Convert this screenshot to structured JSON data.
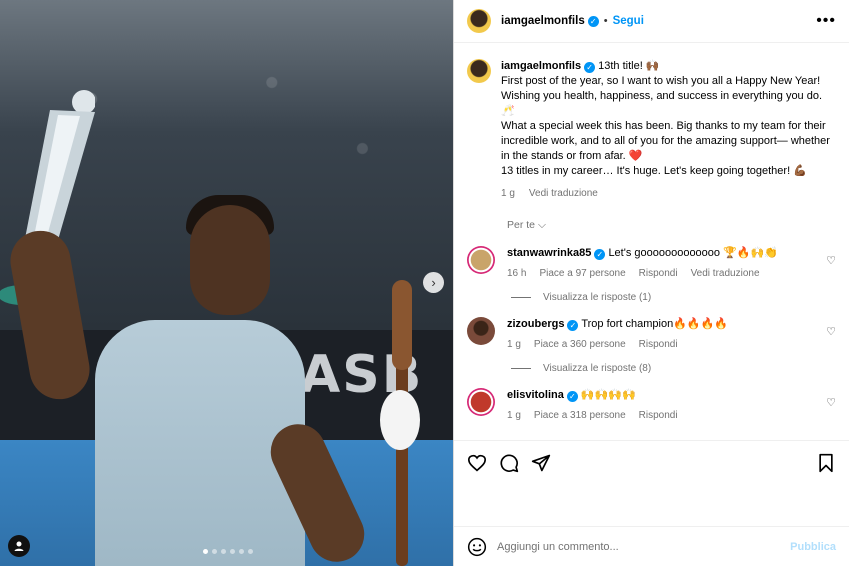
{
  "post": {
    "username": "iamgaelmonfils",
    "follow_label": "Segui",
    "separator": "•",
    "more": "•••",
    "caption_lines": [
      "13th title! 🙌🏾",
      "First post of the year, so I want to wish you all a Happy New Year! Wishing you health, happiness, and success in everything you do. 🥂",
      "What a special week this has been. Big thanks to my team for their incredible work, and to all of you for the amazing support— whether in the stands or from afar. ❤️",
      "13 titles in my career… It's huge. Let's keep going together! 💪🏾"
    ],
    "caption_time": "1 g",
    "caption_translate": "Vedi traduzione",
    "photo": {
      "banner_text": "ASB",
      "carousel_total": 6,
      "carousel_index": 1
    }
  },
  "sort": {
    "label": "Per te",
    "chevron": "chevron-down-icon"
  },
  "comments": [
    {
      "username": "stanwawrinka85",
      "text": "Let's gooooooooooooo 🏆🔥🙌👏",
      "time": "16 h",
      "likes": "Piace a 97 persone",
      "reply": "Rispondi",
      "translate": "Vedi traduzione",
      "view_replies": "Visualizza le risposte (1)",
      "avatar_color": "#c9a46a",
      "ring": "#d62976"
    },
    {
      "username": "zizoubergs",
      "text": "Trop fort champion🔥🔥🔥🔥",
      "time": "1 g",
      "likes": "Piace a 360 persone",
      "reply": "Rispondi",
      "view_replies": "Visualizza le risposte (8)",
      "avatar_color": "#7a4a3a"
    },
    {
      "username": "elisvitolina",
      "text": "🙌🙌🙌🙌",
      "time": "1 g",
      "likes": "Piace a 318 persone",
      "reply": "Rispondi",
      "avatar_color": "#c0392b",
      "ring": "#d62976"
    }
  ],
  "composer": {
    "placeholder": "Aggiungi un commento...",
    "publish": "Pubblica"
  },
  "colors": {
    "accent": "#0095f6",
    "muted": "#737373"
  }
}
